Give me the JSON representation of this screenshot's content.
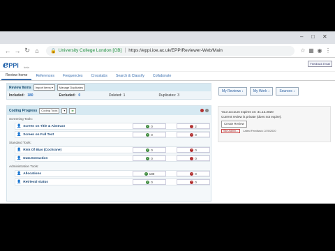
{
  "browser": {
    "window_controls": [
      "–",
      "□",
      "✕"
    ],
    "org_name": "University College London [GB]",
    "url": "https://eppi.ioe.ac.uk/EPPIReviewer-Web/Main"
  },
  "app": {
    "logo_text": "PPI",
    "logo_beta": "beta",
    "feedback_label": "Feedback Email"
  },
  "nav": [
    "Review home",
    "References",
    "Frequencies",
    "Crosstabs",
    "Search & Classify",
    "Collaborate"
  ],
  "review_items": {
    "title": "Review Items",
    "import_label": "Import items",
    "manage_dup_label": "Manage Duplicates",
    "included_label": "Included:",
    "included_value": "180",
    "excluded_label": "Excluded:",
    "excluded_value": "0",
    "deleted_label": "Deleted:",
    "deleted_value": "1",
    "duplicates_label": "Duplicates:",
    "duplicates_value": "3"
  },
  "right_buttons": [
    "My Reviews",
    "My Work",
    "Sources"
  ],
  "account": {
    "expiry": "Your account expires on: 31.12.2020",
    "review_note": "Current review is private (does not expire).",
    "create_label": "Create Review",
    "site_admin_label": "Site Admin...",
    "latest_feedback": "Latest Feedback: 2/20/2020"
  },
  "coding": {
    "title": "Coding Progress",
    "tools_label": "Coding Tools",
    "sections": [
      {
        "label": "Screening Tools:",
        "tools": [
          {
            "name": "Screen on Title & Abstract",
            "a": "0",
            "b": "2"
          },
          {
            "name": "Screen on Full Text",
            "a": "0",
            "b": "0"
          }
        ]
      },
      {
        "label": "Standard Tools:",
        "tools": [
          {
            "name": "Risk Of Bias (Cochrane)",
            "a": "0",
            "b": "0"
          },
          {
            "name": "Data Extraction",
            "a": "0",
            "b": "0"
          }
        ]
      },
      {
        "label": "Administration Tools:",
        "tools": [
          {
            "name": "Allocations",
            "a": "180",
            "b": "0"
          },
          {
            "name": "Retrieval status",
            "a": "0",
            "b": "0"
          }
        ]
      }
    ]
  },
  "colors": {
    "accent": "#3a6fb0",
    "ok": "#3e8a3e",
    "bad": "#b23030"
  }
}
